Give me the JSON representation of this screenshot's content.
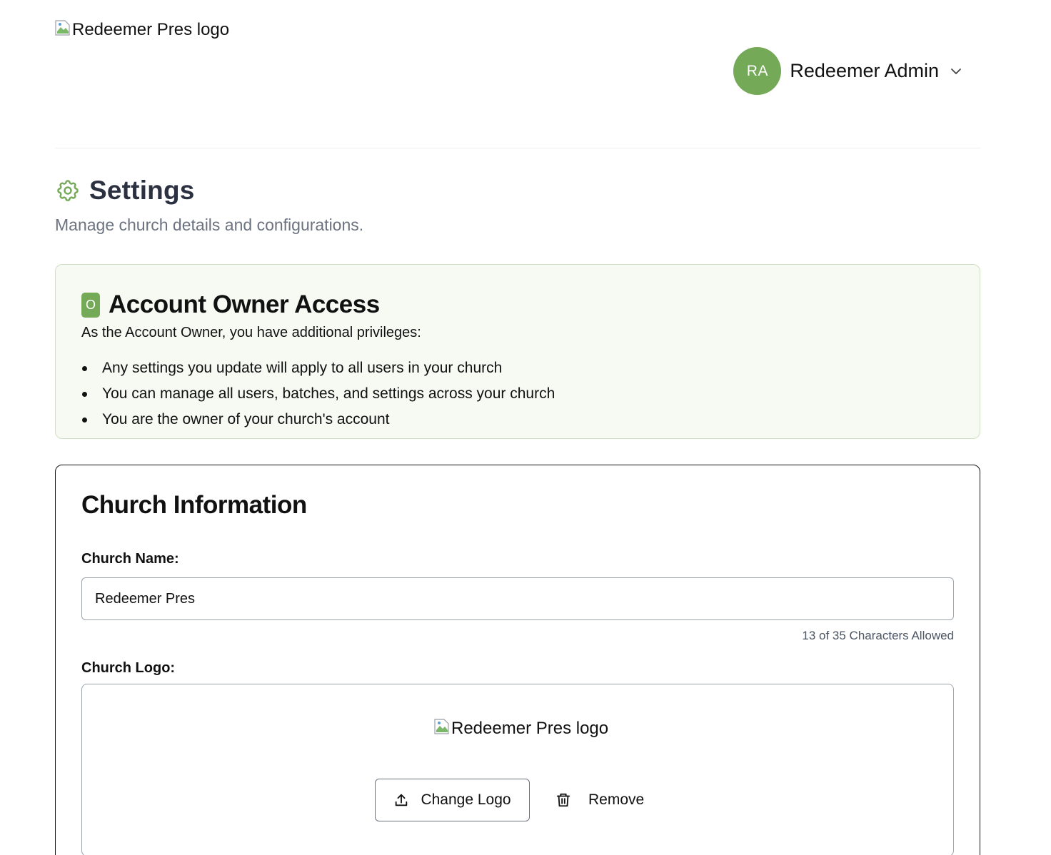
{
  "header": {
    "logo_alt": "Redeemer Pres logo",
    "user": {
      "initials": "RA",
      "name": "Redeemer Admin",
      "avatar_color": "#74a957"
    }
  },
  "page": {
    "title": "Settings",
    "subtitle": "Manage church details and configurations.",
    "icon": "gear-icon"
  },
  "owner_access": {
    "badge": "O",
    "title": "Account Owner Access",
    "intro": "As the Account Owner, you have additional privileges:",
    "items": [
      "Any settings you update will apply to all users in your church",
      "You can manage all users, batches, and settings across your church",
      "You are the owner of your church's account"
    ]
  },
  "church_info": {
    "title": "Church Information",
    "name_label": "Church Name:",
    "name_value": "Redeemer Pres",
    "char_count": "13 of 35 Characters Allowed",
    "logo_label": "Church Logo:",
    "logo_alt": "Redeemer Pres logo",
    "change_logo_label": "Change Logo",
    "remove_label": "Remove"
  },
  "colors": {
    "accent": "#74a957",
    "owner_bg": "#f6faf3",
    "title_dark": "#2b3140",
    "muted": "#6b7280"
  }
}
